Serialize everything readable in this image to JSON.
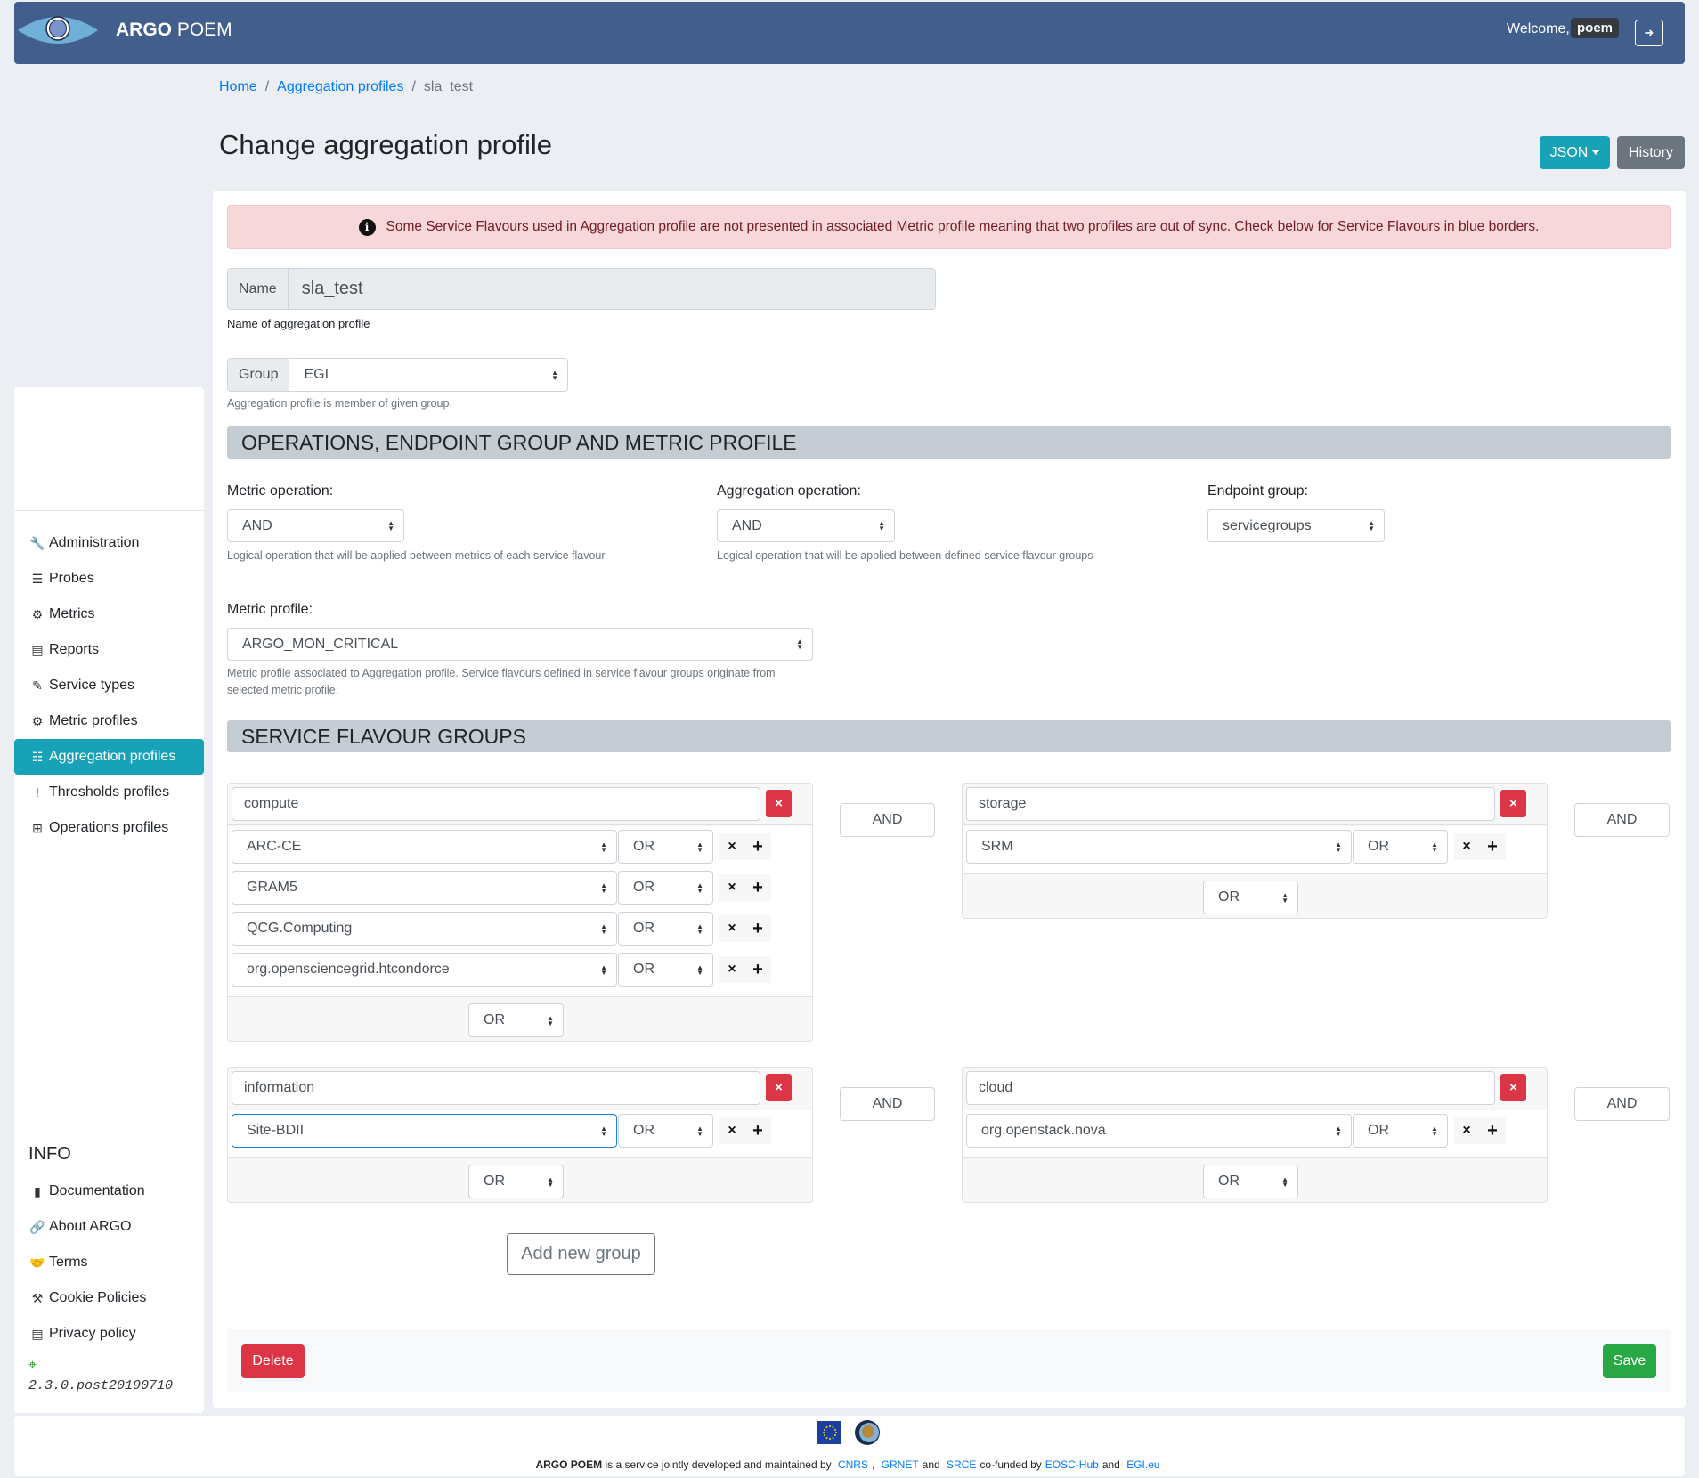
{
  "header": {
    "brand_bold": "ARGO",
    "brand_rest": " POEM",
    "welcome": "Welcome,",
    "username": "poem",
    "logout_icon": "sign-out-icon"
  },
  "breadcrumb": {
    "items": [
      {
        "label": "Home",
        "link": true
      },
      {
        "label": "Aggregation profiles",
        "link": true
      },
      {
        "label": "sla_test",
        "link": false
      }
    ],
    "separator": "/"
  },
  "page": {
    "title": "Change aggregation profile",
    "json_button": "JSON",
    "history_button": "History"
  },
  "sidebar": {
    "items": [
      {
        "label": "Administration",
        "icon": "wrench-icon",
        "glyph": "🔧",
        "active": false
      },
      {
        "label": "Probes",
        "icon": "server-icon",
        "glyph": "☰",
        "active": false
      },
      {
        "label": "Metrics",
        "icon": "cog-icon",
        "glyph": "⚙",
        "active": false
      },
      {
        "label": "Reports",
        "icon": "file-icon",
        "glyph": "▤",
        "active": false
      },
      {
        "label": "Service types",
        "icon": "highlighter-icon",
        "glyph": "✎",
        "active": false
      },
      {
        "label": "Metric profiles",
        "icon": "cogs-icon",
        "glyph": "⚙",
        "active": false
      },
      {
        "label": "Aggregation profiles",
        "icon": "tasks-icon",
        "glyph": "☷",
        "active": true
      },
      {
        "label": "Thresholds profiles",
        "icon": "exclamation-icon",
        "glyph": "!",
        "active": false
      },
      {
        "label": "Operations profiles",
        "icon": "table-icon",
        "glyph": "⊞",
        "active": false
      }
    ],
    "info_title": "INFO",
    "info_items": [
      {
        "label": "Documentation",
        "icon": "book-icon",
        "glyph": "▮"
      },
      {
        "label": "About ARGO",
        "icon": "link-icon",
        "glyph": "🔗"
      },
      {
        "label": "Terms",
        "icon": "handshake-icon",
        "glyph": "🤝"
      },
      {
        "label": "Cookie Policies",
        "icon": "gavel-icon",
        "glyph": "⚒"
      },
      {
        "label": "Privacy policy",
        "icon": "newspaper-icon",
        "glyph": "▤"
      }
    ],
    "version_icon": "crosshairs-icon",
    "version": "2.3.0.post20190710"
  },
  "alert": {
    "icon": "info-circle-icon",
    "text": "Some Service Flavours used in Aggregation profile are not presented in associated Metric profile meaning that two profiles are out of sync. Check below for Service Flavours in blue borders."
  },
  "form": {
    "name_label": "Name",
    "name_value": "sla_test",
    "name_help": "Name of aggregation profile",
    "group_label": "Group",
    "group_value": "EGI",
    "group_help": "Aggregation profile is member of given group.",
    "section1_title": "OPERATIONS, ENDPOINT GROUP AND METRIC PROFILE",
    "metric_operation_label": "Metric operation:",
    "metric_operation_value": "AND",
    "metric_operation_help": "Logical operation that will be applied between metrics of each service flavour",
    "aggregation_operation_label": "Aggregation operation:",
    "aggregation_operation_value": "AND",
    "aggregation_operation_help": "Logical operation that will be applied between defined service flavour groups",
    "endpoint_group_label": "Endpoint group:",
    "endpoint_group_value": "servicegroups",
    "metric_profile_label": "Metric profile:",
    "metric_profile_value": "ARGO_MON_CRITICAL",
    "metric_profile_help_1": "Metric profile associated to Aggregation profile. Service flavours defined in service flavour groups originate from",
    "metric_profile_help_2": "selected metric profile.",
    "section2_title": "SERVICE FLAVOUR GROUPS"
  },
  "groups": [
    {
      "name": "compute",
      "services": [
        {
          "name": "ARC-CE",
          "op": "OR",
          "out_of_sync": false
        },
        {
          "name": "GRAM5",
          "op": "OR",
          "out_of_sync": false
        },
        {
          "name": "QCG.Computing",
          "op": "OR",
          "out_of_sync": false
        },
        {
          "name": "org.opensciencegrid.htcondorce",
          "op": "OR",
          "out_of_sync": false
        }
      ],
      "group_op": "OR",
      "join_op": "AND"
    },
    {
      "name": "storage",
      "services": [
        {
          "name": "SRM",
          "op": "OR",
          "out_of_sync": false
        }
      ],
      "group_op": "OR",
      "join_op": "AND"
    },
    {
      "name": "information",
      "services": [
        {
          "name": "Site-BDII",
          "op": "OR",
          "out_of_sync": true
        }
      ],
      "group_op": "OR",
      "join_op": "AND"
    },
    {
      "name": "cloud",
      "services": [
        {
          "name": "org.openstack.nova",
          "op": "OR",
          "out_of_sync": false
        }
      ],
      "group_op": "OR",
      "join_op": "AND"
    }
  ],
  "actions": {
    "add_group": "Add new group",
    "delete": "Delete",
    "save": "Save",
    "remove_glyph": "×",
    "add_glyph": "+",
    "delete_group_glyph": "×"
  },
  "footer": {
    "brand": "ARGO POEM",
    "text1": "is a service jointly developed and maintained by",
    "cnrs": "CNRS",
    "comma": ",",
    "grnet": "GRNET",
    "and1": "and",
    "srce": "SRCE",
    "cofunded": "co-funded by",
    "eosc": "EOSC-Hub",
    "and2": "and",
    "egi": "EGI.eu"
  }
}
